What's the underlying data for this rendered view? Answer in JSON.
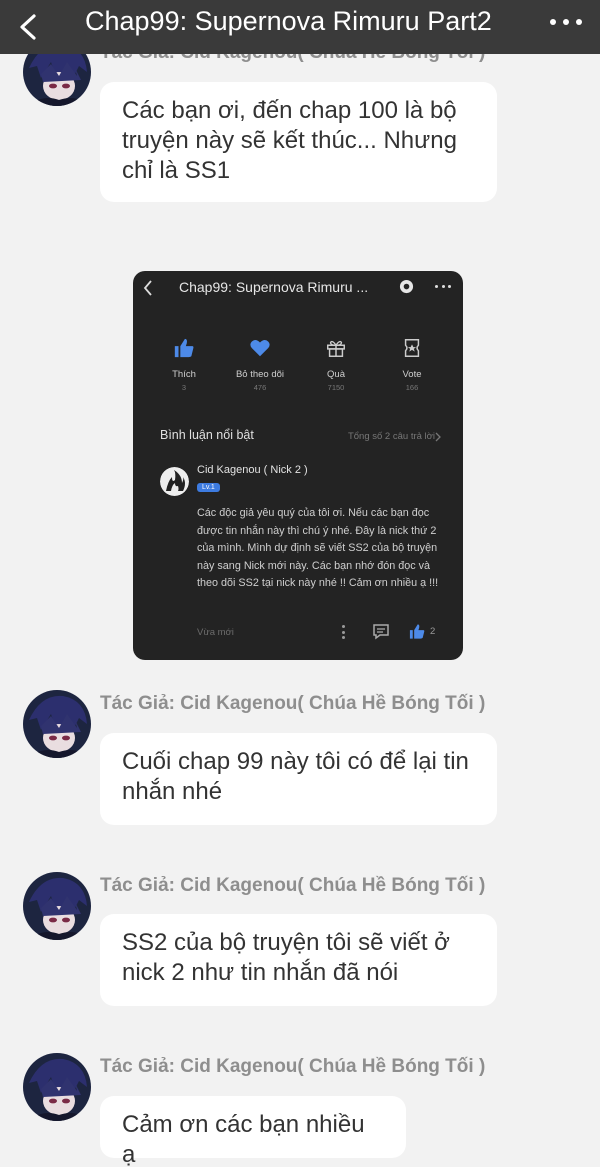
{
  "topbar": {
    "title": "Chap99: Supernova Rimuru Part2",
    "back_icon": "chevron-left-icon",
    "more_icon": "more-horizontal-icon"
  },
  "messages": [
    {
      "sender": "Tác Giả: Cid Kagenou( Chúa Hề Bóng Tối )",
      "text": "Các bạn ơi, đến chap 100 là bộ truyện này sẽ kết thúc... Nhưng chỉ là SS1"
    },
    {
      "sender": "Tác Giả: Cid Kagenou( Chúa Hề Bóng Tối )",
      "text": "Cuối chap 99 này tôi có để lại tin nhắn nhé"
    },
    {
      "sender": "Tác Giả: Cid Kagenou( Chúa Hề Bóng Tối )",
      "text": "SS2 của bộ truyện tôi sẽ viết ở nick 2 như tin nhắn đã nói"
    },
    {
      "sender": "Tác Giả: Cid Kagenou( Chúa Hề Bóng Tối )",
      "text": "Cảm ơn các bạn nhiều ạ"
    }
  ],
  "screenshot": {
    "title": "Chap99: Supernova Rimuru ...",
    "stats": [
      {
        "label": "Thích",
        "count": "3",
        "icon": "thumbs-up-icon"
      },
      {
        "label": "Bỏ theo dõi",
        "count": "476",
        "icon": "heart-icon"
      },
      {
        "label": "Quà",
        "count": "7150",
        "icon": "gift-icon"
      },
      {
        "label": "Vote",
        "count": "166",
        "icon": "vote-ticket-icon"
      }
    ],
    "section_title": "Bình luận nổi bật",
    "total_replies": "Tổng số 2 câu trả lời",
    "comment": {
      "author": "Cid Kagenou ( Nick 2 )",
      "level": "Lv.1",
      "text": "Các độc giả yêu quý của tôi ơi. Nếu các bạn đọc được tin nhắn này thì chú ý nhé. Đây là nick thứ 2 của mình. Mình dự định sẽ viết SS2 của bộ truyện này sang Nick mới này. Các bạn nhớ đón đọc và theo dõi SS2 tại nick này nhé !! Cảm ơn nhiều ạ !!!",
      "time": "Vừa mới",
      "likes": "2"
    },
    "accent_color": "#4d8ae8"
  },
  "colors": {
    "background": "#f2f2f2",
    "topbar": "#3a3a3a",
    "bubble": "#ffffff",
    "sender": "#8e8e8e"
  }
}
